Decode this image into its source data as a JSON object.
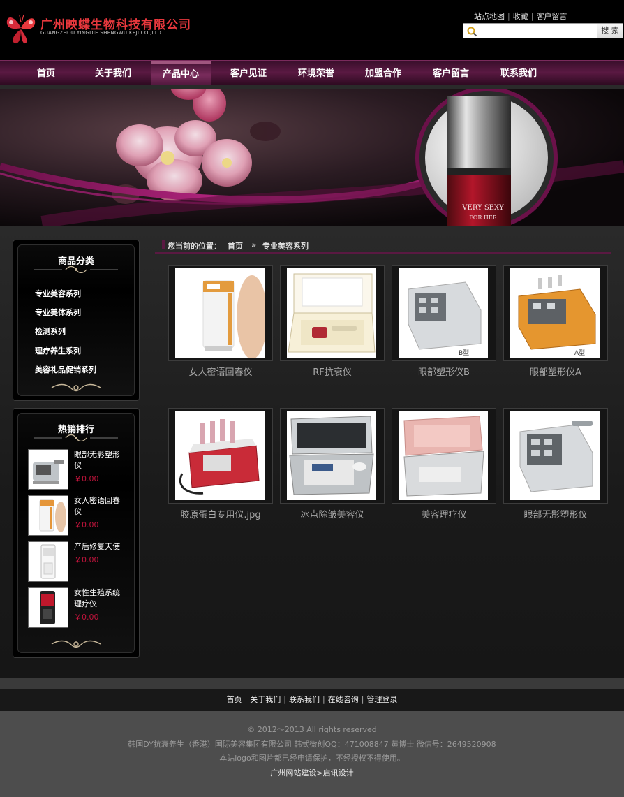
{
  "header": {
    "logo_zh": "广州映蝶生物科技有限公司",
    "logo_en": "GUANGZHOU YINGDIE SHENGWU KEJI CO.,LTD",
    "top_links": [
      "站点地图",
      "收藏",
      "客户留言"
    ],
    "search_placeholder": "",
    "search_button": "搜 索"
  },
  "nav": {
    "items": [
      "首页",
      "关于我们",
      "产品中心",
      "客户见证",
      "环境荣誉",
      "加盟合作",
      "客户留言",
      "联系我们"
    ],
    "active_index": 2
  },
  "banner": {
    "text1": "VERY SEXY",
    "text2": "FOR HER"
  },
  "sidebar": {
    "category_title": "商品分类",
    "categories": [
      "专业美容系列",
      "专业美体系列",
      "检测系列",
      "理疗养生系列",
      "美容礼品促销系列"
    ],
    "hot_title": "热销排行",
    "hot_items": [
      {
        "name": "眼部无影塑形仪",
        "price": "￥0.00"
      },
      {
        "name": "女人密语回春仪",
        "price": "￥0.00"
      },
      {
        "name": "产后修复天使",
        "price": "￥0.00"
      },
      {
        "name": "女性生殖系统理疗仪",
        "price": "￥0.00"
      }
    ]
  },
  "breadcrumb": {
    "label": "您当前的位置：",
    "home": "首页",
    "sep": "»",
    "current": "专业美容系列"
  },
  "products": [
    {
      "name": "女人密语回春仪"
    },
    {
      "name": "RF抗衰仪"
    },
    {
      "name": "眼部塑形仪B",
      "tag": "B型"
    },
    {
      "name": "眼部塑形仪A",
      "tag": "A型"
    },
    {
      "name": "胶原蛋白专用仪.jpg"
    },
    {
      "name": "冰点除皱美容仪"
    },
    {
      "name": "美容理疗仪"
    },
    {
      "name": "眼部无影塑形仪"
    }
  ],
  "footer": {
    "nav": [
      "首页",
      "关于我们",
      "联系我们",
      "在线咨询",
      "管理登录"
    ],
    "copyright": "© 2012～2013 All rights reserved",
    "company": "韩国DY抗衰养生（香港）国际美容集团有限公司   韩式微创QQ：471008847 黄博士 微信号：2649520908",
    "notice": "本站logo和图片都已经申请保护，不经授权不得使用。",
    "credit_prefix": "广州网站建设",
    "credit_link": "启讯设计"
  },
  "colors": {
    "accent": "#5a1942",
    "price": "#c0143c",
    "logo": "#e8383d"
  }
}
